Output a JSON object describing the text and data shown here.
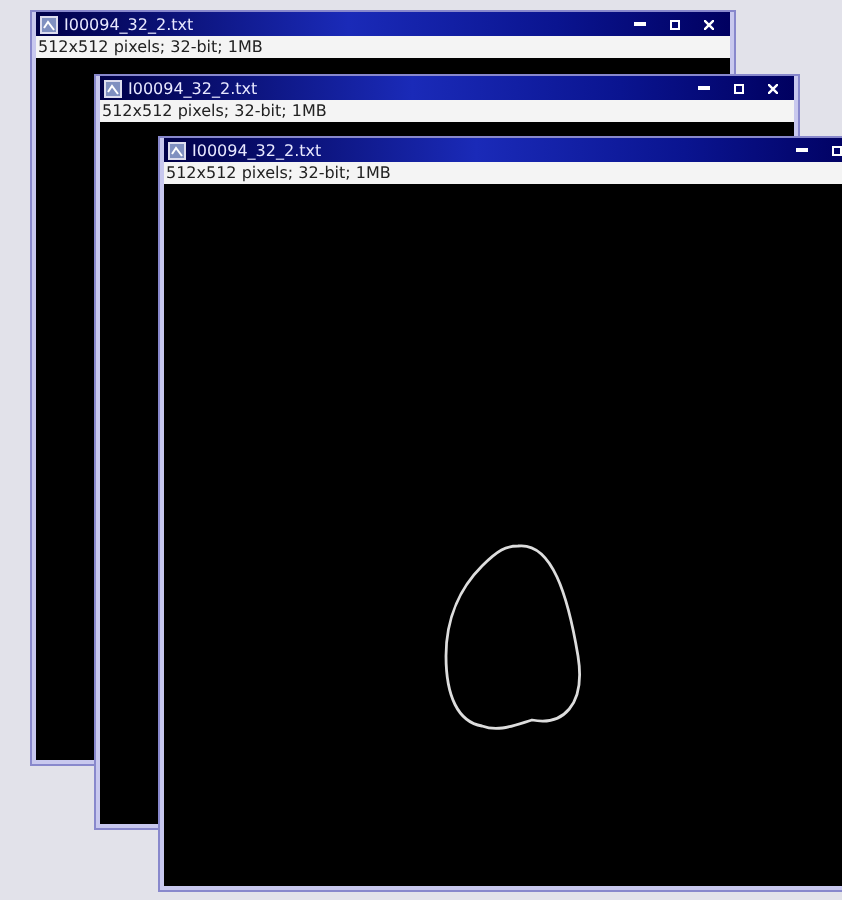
{
  "windows": [
    {
      "title": "I00094_32_2.txt",
      "info": "512x512 pixels; 32-bit; 1MB",
      "buttons": [
        {
          "kind": "minimize"
        },
        {
          "kind": "maximize"
        },
        {
          "kind": "close"
        }
      ]
    },
    {
      "title": "I00094_32_2.txt",
      "info": "512x512 pixels; 32-bit; 1MB",
      "buttons": [
        {
          "kind": "minimize"
        },
        {
          "kind": "maximize"
        },
        {
          "kind": "close"
        }
      ]
    },
    {
      "title": "I00094_32_2.txt",
      "info": "512x512 pixels; 32-bit; 1MB",
      "buttons": [
        {
          "kind": "minimize"
        },
        {
          "kind": "maximize"
        }
      ],
      "image": {
        "kind": "contour"
      }
    }
  ]
}
